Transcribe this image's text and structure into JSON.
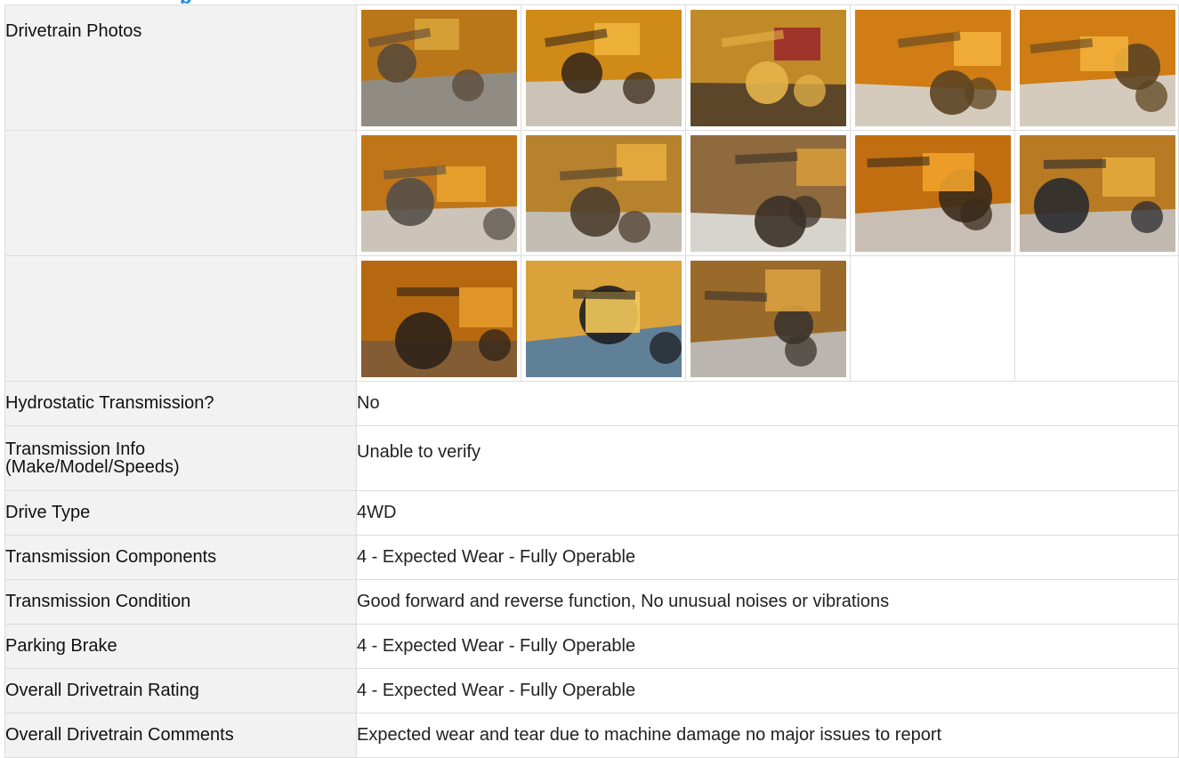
{
  "section_title": "p",
  "photos_label": "Drivetrain Photos",
  "photo_rows": [
    [
      {
        "icon": "photo-thumbnail",
        "palette": [
          "#b9771a",
          "#d9a33a",
          "#5a4a3a",
          "#8a8f96"
        ]
      },
      {
        "icon": "photo-thumbnail",
        "palette": [
          "#d08a18",
          "#f0b43a",
          "#3a2a1a",
          "#c9cdd2"
        ]
      },
      {
        "icon": "photo-thumbnail",
        "palette": [
          "#c08a28",
          "#9a2a2a",
          "#e6b44a",
          "#4a3a2a"
        ]
      },
      {
        "icon": "photo-thumbnail",
        "palette": [
          "#cf7d14",
          "#f2b038",
          "#5c4422",
          "#d6d8da"
        ]
      },
      {
        "icon": "photo-thumbnail",
        "palette": [
          "#cf7d14",
          "#f2b038",
          "#5c4422",
          "#d6d8da"
        ]
      }
    ],
    [
      {
        "icon": "photo-thumbnail",
        "palette": [
          "#c07618",
          "#e9a32e",
          "#55504a",
          "#cfd2d6"
        ]
      },
      {
        "icon": "photo-thumbnail",
        "palette": [
          "#b7822e",
          "#e7ac40",
          "#4c3e2f",
          "#c6c8cb"
        ]
      },
      {
        "icon": "photo-thumbnail",
        "palette": [
          "#8e6a3e",
          "#d59a3a",
          "#3b3128",
          "#e4e6e8"
        ]
      },
      {
        "icon": "photo-thumbnail",
        "palette": [
          "#c06e10",
          "#f0a22a",
          "#3a2a1a",
          "#c9ccd0"
        ]
      },
      {
        "icon": "photo-thumbnail",
        "palette": [
          "#b87a22",
          "#e4aa3c",
          "#2a2a2e",
          "#c2c4c8"
        ]
      }
    ],
    [
      {
        "icon": "photo-thumbnail",
        "palette": [
          "#b56810",
          "#e39a2a",
          "#2e2218",
          "#7a5a3a"
        ]
      },
      {
        "icon": "photo-thumbnail",
        "palette": [
          "#d9a23a",
          "#f2c85a",
          "#1e1e22",
          "#4a7aa8"
        ]
      },
      {
        "icon": "photo-thumbnail",
        "palette": [
          "#9a6a2a",
          "#d9a040",
          "#3a342c",
          "#bfc2c6"
        ]
      }
    ]
  ],
  "fields": [
    {
      "label": "Hydrostatic Transmission?",
      "value": "No"
    },
    {
      "label": "Transmission Info (Make/Model/Speeds)",
      "label_lines": [
        "Transmission Info",
        "(Make/Model/Speeds)"
      ],
      "value": "Unable to verify"
    },
    {
      "label": "Drive Type",
      "value": "4WD"
    },
    {
      "label": "Transmission Components",
      "value": "4 - Expected Wear - Fully Operable"
    },
    {
      "label": "Transmission Condition",
      "value": "Good forward and reverse function, No unusual noises or vibrations"
    },
    {
      "label": "Parking Brake",
      "value": "4 - Expected Wear - Fully Operable"
    },
    {
      "label": "Overall Drivetrain Rating",
      "value": "4 - Expected Wear - Fully Operable"
    },
    {
      "label": "Overall Drivetrain Comments",
      "value": "Expected wear and tear due to machine damage no major issues to report"
    }
  ]
}
